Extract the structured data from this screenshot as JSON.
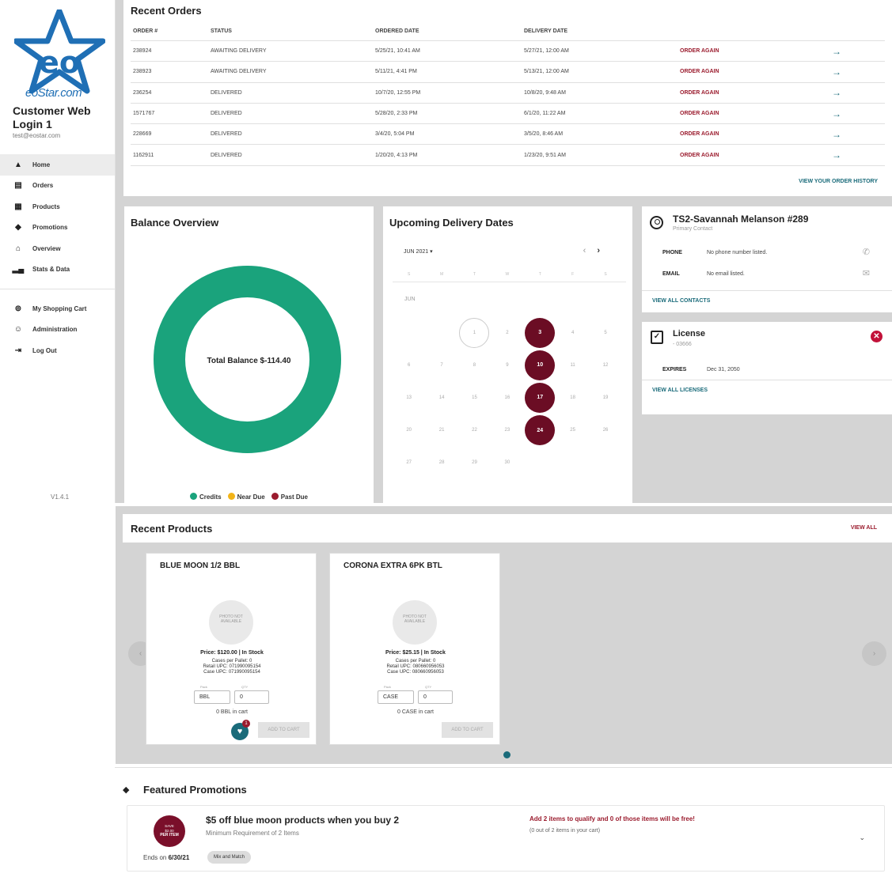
{
  "sidebar": {
    "brand": "eoStar.com",
    "user_name": "Customer Web Login 1",
    "user_email": "test@eostar.com",
    "items": [
      {
        "label": "Home",
        "icon": "home-icon"
      },
      {
        "label": "Orders",
        "icon": "orders-icon"
      },
      {
        "label": "Products",
        "icon": "products-icon"
      },
      {
        "label": "Promotions",
        "icon": "tag-icon"
      },
      {
        "label": "Overview",
        "icon": "bank-icon"
      },
      {
        "label": "Stats & Data",
        "icon": "bar-chart-icon"
      }
    ],
    "secondary": [
      {
        "label": "My Shopping Cart",
        "icon": "cart-icon"
      },
      {
        "label": "Administration",
        "icon": "admin-icon"
      },
      {
        "label": "Log Out",
        "icon": "logout-icon"
      }
    ],
    "version": "V1.4.1"
  },
  "orders": {
    "title": "Recent Orders",
    "columns": [
      "ORDER #",
      "STATUS",
      "ORDERED DATE",
      "DELIVERY DATE"
    ],
    "rows": [
      {
        "id": "238924",
        "status": "AWAITING DELIVERY",
        "ordered": "5/25/21, 10:41 AM",
        "delivery": "5/27/21, 12:00 AM",
        "action": "ORDER AGAIN"
      },
      {
        "id": "238923",
        "status": "AWAITING DELIVERY",
        "ordered": "5/11/21, 4:41 PM",
        "delivery": "5/13/21, 12:00 AM",
        "action": "ORDER AGAIN"
      },
      {
        "id": "236254",
        "status": "DELIVERED",
        "ordered": "10/7/20, 12:55 PM",
        "delivery": "10/8/20, 9:48 AM",
        "action": "ORDER AGAIN"
      },
      {
        "id": "1571767",
        "status": "DELIVERED",
        "ordered": "5/28/20, 2:33 PM",
        "delivery": "6/1/20, 11:22 AM",
        "action": "ORDER AGAIN"
      },
      {
        "id": "228669",
        "status": "DELIVERED",
        "ordered": "3/4/20, 5:04 PM",
        "delivery": "3/5/20, 8:46 AM",
        "action": "ORDER AGAIN"
      },
      {
        "id": "1162911",
        "status": "DELIVERED",
        "ordered": "1/20/20, 4:13 PM",
        "delivery": "1/23/20, 9:51 AM",
        "action": "ORDER AGAIN"
      }
    ],
    "history_link": "VIEW YOUR ORDER HISTORY"
  },
  "balance": {
    "title": "Balance Overview",
    "total": "Total Balance $-114.40",
    "legend": [
      {
        "label": "Credits",
        "color": "#1aa37c"
      },
      {
        "label": "Near Due",
        "color": "#f2b418"
      },
      {
        "label": "Past Due",
        "color": "#9b1c2e"
      }
    ]
  },
  "delivery": {
    "title": "Upcoming Delivery Dates",
    "month_select": "JUN 2021",
    "weekdays": [
      "S",
      "M",
      "T",
      "W",
      "T",
      "F",
      "S"
    ],
    "month_label": "JUN",
    "days": [
      "",
      "",
      "1",
      "2",
      "3",
      "4",
      "5",
      "6",
      "7",
      "8",
      "9",
      "10",
      "11",
      "12",
      "13",
      "14",
      "15",
      "16",
      "17",
      "18",
      "19",
      "20",
      "21",
      "22",
      "23",
      "24",
      "25",
      "26",
      "27",
      "28",
      "29",
      "30",
      "",
      "",
      ""
    ],
    "delivery_days": [
      "3",
      "10",
      "17",
      "24"
    ],
    "today": "1"
  },
  "contact": {
    "name": "TS2-Savannah Melanson #289",
    "role": "Primary Contact",
    "phone_label": "PHONE",
    "phone_value": "No phone number listed.",
    "email_label": "EMAIL",
    "email_value": "No email listed.",
    "link": "VIEW ALL CONTACTS"
  },
  "license": {
    "title": "License",
    "number": "- 03666",
    "expires_label": "EXPIRES",
    "expires_value": "Dec 31, 2050",
    "link": "VIEW ALL LICENSES"
  },
  "products": {
    "title": "Recent Products",
    "view_all": "VIEW ALL",
    "photo_placeholder": "PHOTO NOT AVAILABLE",
    "pack_label": "Pack",
    "qty_label": "QTY",
    "add_label": "ADD TO CART",
    "items": [
      {
        "name": "BLUE MOON 1/2 BBL",
        "price": "Price: $120.00 | In Stock",
        "cases": "Cases per Pallet: 0",
        "retail_upc": "Retail UPC: 071990095154",
        "case_upc": "Case UPC: 071990095154",
        "pack": "BBL",
        "qty": "0",
        "in_cart": "0 BBL in cart"
      },
      {
        "name": "CORONA EXTRA 6PK BTL",
        "price": "Price: $25.15 | In Stock",
        "cases": "Cases per Pallet: 0",
        "retail_upc": "Retail UPC: 080660956053",
        "case_upc": "Case UPC: 080660956053",
        "pack": "CASE",
        "qty": "0",
        "in_cart": "0 CASE in cart"
      }
    ],
    "favorite_badge": "1"
  },
  "promotions": {
    "title": "Featured Promotions",
    "badge_line1": "SAVE",
    "badge_line2": "$2.00",
    "badge_line3": "PER ITEM",
    "ends_prefix": "Ends on",
    "ends_date": "6/30/21",
    "promo_title": "$5 off blue moon products when you buy 2",
    "requirement": "Minimum Requirement of 2 Items",
    "chip": "Mix and Match",
    "qualify": "Add 2 items to qualify and 0 of those items will be free!",
    "qualify_sub": "(0 out of 2 items in your cart)"
  }
}
